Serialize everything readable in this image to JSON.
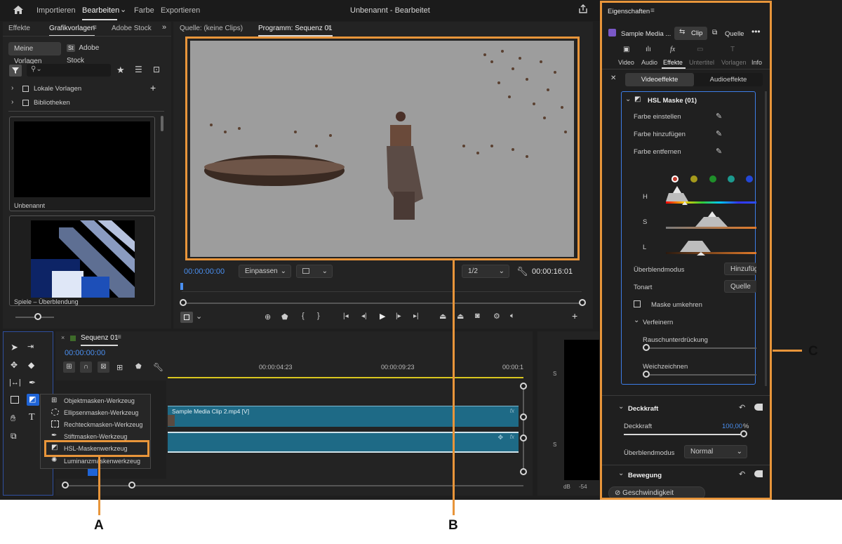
{
  "topbar": {
    "menu": [
      "Importieren",
      "Bearbeiten",
      "Farbe",
      "Exportieren"
    ],
    "active_menu": "Bearbeiten",
    "title": "Unbenannt - Bearbeitet"
  },
  "left_panel": {
    "tabs": [
      "Effekte",
      "Grafikvorlagen",
      "Adobe Stock"
    ],
    "subtabs": [
      "Meine Vorlagen",
      "Adobe Stock"
    ],
    "tree": [
      "Lokale Vorlagen",
      "Bibliotheken"
    ],
    "thumbs": [
      "Unbenannt",
      "Spiele – Überblendung"
    ]
  },
  "monitor": {
    "source_tab": "Quelle: (keine Clips)",
    "program_tab": "Programm: Sequenz 01",
    "timecode": "00:00:00:00",
    "fit": "Einpassen",
    "resolution": "1/2",
    "duration": "00:00:16:01"
  },
  "timeline": {
    "sequence": "Sequenz 01",
    "timecode": "00:00:00:00",
    "ruler": [
      "00:00:04:23",
      "00:00:09:23",
      "00:00:1"
    ],
    "clip_label": "Sample Media Clip 2.mp4 [V]"
  },
  "tool_menu": {
    "items": [
      "Objektmasken-Werkzeug",
      "Ellipsenmasken-Werkzeug",
      "Rechteckmasken-Werkzeug",
      "Stiftmasken-Werkzeug",
      "HSL-Maskenwerkzeug",
      "Luminanzmaskenwerkzeug"
    ],
    "highlighted": "HSL-Maskenwerkzeug"
  },
  "meter": {
    "labels": [
      "S",
      "S"
    ],
    "scale": [
      "dB",
      "-54"
    ]
  },
  "properties": {
    "title": "Eigenschaften",
    "source_name": "Sample Media ...",
    "clip_btn": "Clip",
    "source_btn": "Quelle",
    "subtabs": [
      "Video",
      "Audio",
      "Effekte",
      "Untertitel",
      "Vorlagen",
      "Info"
    ],
    "active_subtab": "Effekte",
    "effect_tabs": [
      "Videoeffekte",
      "Audioeffekte"
    ],
    "hsl_title": "HSL Maske (01)",
    "color_rows": [
      "Farbe einstellen",
      "Farbe hinzufügen",
      "Farbe entfernen"
    ],
    "colors": [
      "#c0392b",
      "#a59a1c",
      "#1f8f2a",
      "#1c9a8f",
      "#2347d6"
    ],
    "hsl_letters": [
      "H",
      "S",
      "L"
    ],
    "blend_label": "Überblendmodus",
    "blend_value": "Hinzufüge",
    "tonart_label": "Tonart",
    "tonart_value": "Quelle (fa",
    "invert_label": "Maske umkehren",
    "refine_label": "Verfeinern",
    "noise_label": "Rauschunterdrückung",
    "soften_label": "Weichzeichnen",
    "opacity_section": "Deckkraft",
    "opacity_label": "Deckkraft",
    "opacity_value": "100,00",
    "opacity_unit": "%",
    "opacity_blend_label": "Überblendmodus",
    "opacity_blend_value": "Normal",
    "motion_section": "Bewegung",
    "speed_btn": "Geschwindigkeit anpassen"
  },
  "callouts": [
    "A",
    "B",
    "C"
  ]
}
